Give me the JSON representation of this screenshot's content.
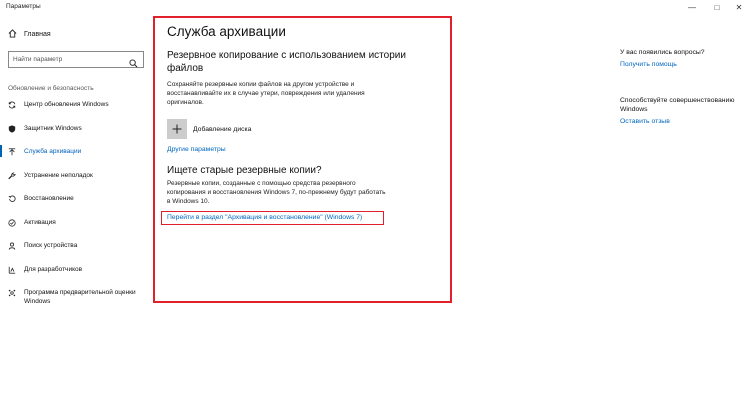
{
  "window": {
    "title": "Параметры",
    "minimize": "—",
    "maximize": "□",
    "close": "✕"
  },
  "sidebar": {
    "home_label": "Главная",
    "search_placeholder": "Найти параметр",
    "section_title": "Обновление и безопасность",
    "items": [
      {
        "label": "Центр обновления Windows",
        "icon": "sync-icon",
        "active": false
      },
      {
        "label": "Защитник Windows",
        "icon": "shield-icon",
        "active": false
      },
      {
        "label": "Служба архивации",
        "icon": "backup-icon",
        "active": true
      },
      {
        "label": "Устранение неполадок",
        "icon": "wrench-icon",
        "active": false
      },
      {
        "label": "Восстановление",
        "icon": "restore-icon",
        "active": false
      },
      {
        "label": "Активация",
        "icon": "check-circle-icon",
        "active": false
      },
      {
        "label": "Поиск устройства",
        "icon": "person-pin-icon",
        "active": false
      },
      {
        "label": "Для разработчиков",
        "icon": "developer-icon",
        "active": false
      },
      {
        "label": "Программа предварительной оценки Windows",
        "icon": "insider-icon",
        "active": false
      }
    ]
  },
  "main": {
    "page_title": "Служба архивации",
    "section1_heading": "Резервное копирование с использованием истории файлов",
    "section1_text": "Сохраняйте резервные копии файлов на другом устройстве и восстанавливайте их в случае утери, повреждения или удаления оригиналов.",
    "add_disk_label": "Добавление диска",
    "more_options_link": "Другие параметры",
    "section2_heading": "Ищете старые резервные копии?",
    "section2_text": "Резервные копии, созданные с помощью средства резервного копирования и восстановления Windows 7, по-прежнему будут работать в Windows 10.",
    "legacy_link": "Перейти в раздел \"Архивация и восстановление\" (Windows 7)"
  },
  "right": {
    "question_text": "У вас появились вопросы?",
    "help_link": "Получить помощь",
    "improve_text": "Способствуйте совершенствованию Windows",
    "feedback_link": "Оставить отзыв"
  },
  "colors": {
    "accent": "#0067c0",
    "highlight_box": "#e0212b"
  }
}
